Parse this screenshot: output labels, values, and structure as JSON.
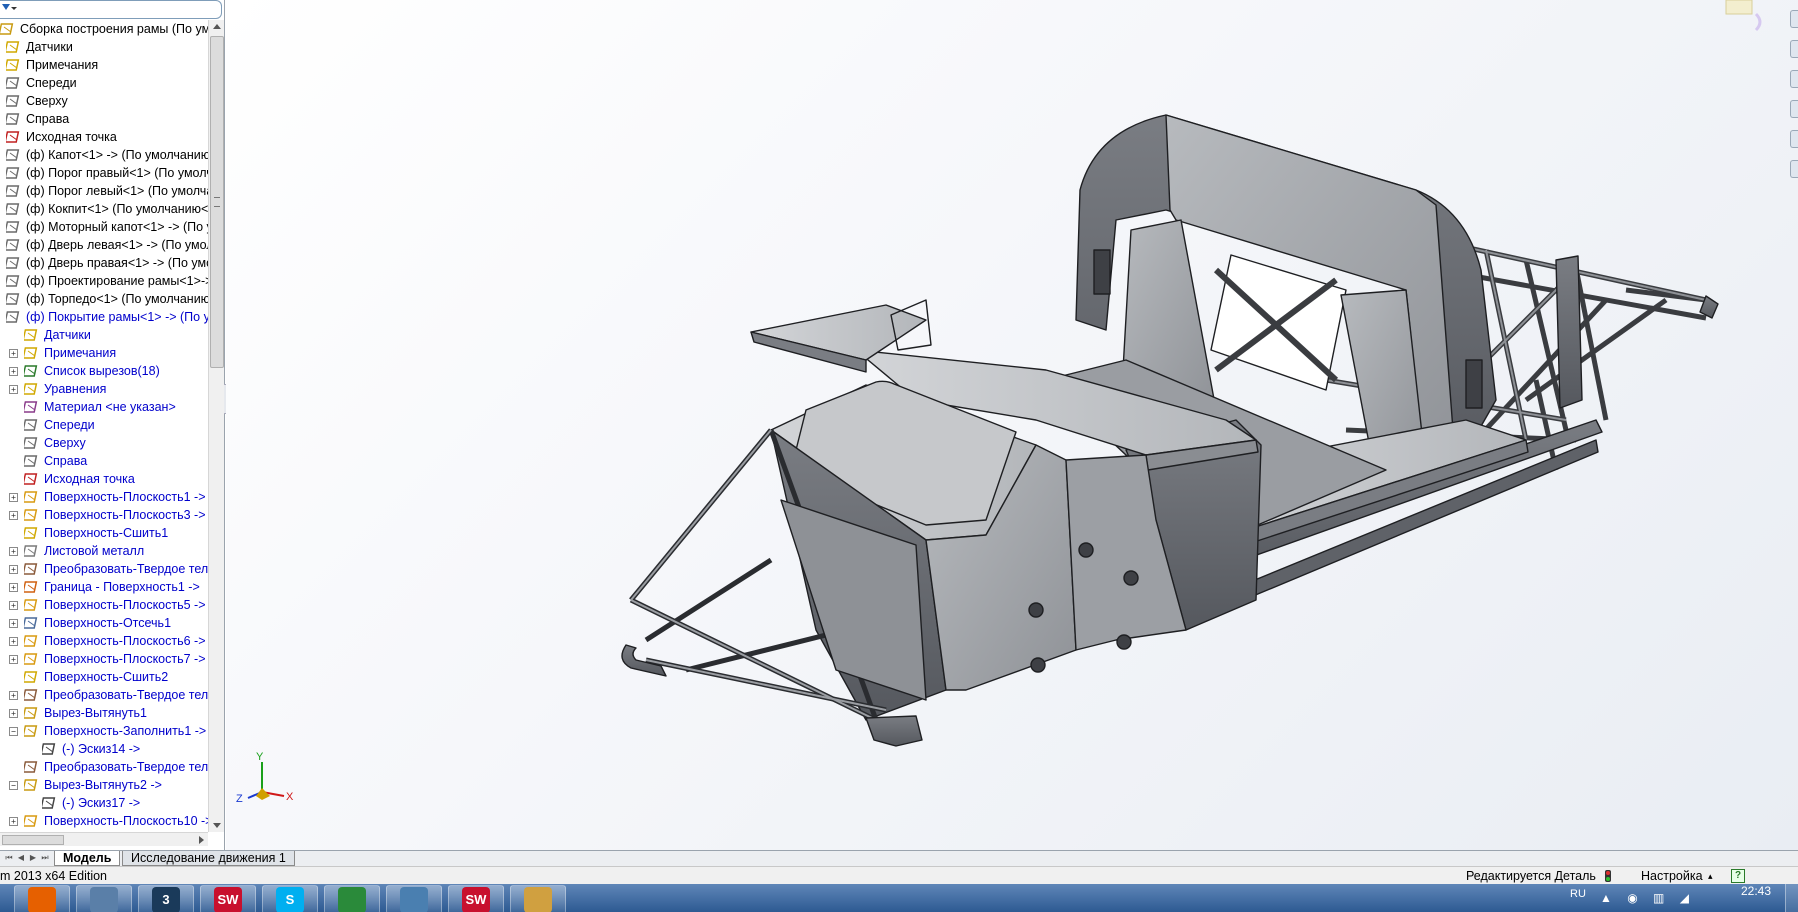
{
  "tree": {
    "rows": [
      {
        "label": "Сборка построения рамы  (По умол",
        "icon": "assembly-icon",
        "indent": 0,
        "expander": "",
        "blue": false
      },
      {
        "label": "Датчики",
        "icon": "sensors-icon",
        "indent": 1,
        "expander": "",
        "blue": false
      },
      {
        "label": "Примечания",
        "icon": "annotations-icon",
        "indent": 1,
        "expander": "",
        "blue": false
      },
      {
        "label": "Спереди",
        "icon": "plane-icon",
        "indent": 1,
        "expander": "",
        "blue": false
      },
      {
        "label": "Сверху",
        "icon": "plane-icon",
        "indent": 1,
        "expander": "",
        "blue": false
      },
      {
        "label": "Справа",
        "icon": "plane-icon",
        "indent": 1,
        "expander": "",
        "blue": false
      },
      {
        "label": "Исходная точка",
        "icon": "origin-icon",
        "indent": 1,
        "expander": "",
        "blue": false
      },
      {
        "label": "(ф) Капот<1> -> (По умолчанию",
        "icon": "part-icon",
        "indent": 1,
        "expander": "",
        "blue": false
      },
      {
        "label": "(ф) Порог правый<1> (По умолч",
        "icon": "part-icon",
        "indent": 1,
        "expander": "",
        "blue": false
      },
      {
        "label": "(ф) Порог левый<1> (По умолча",
        "icon": "part-icon",
        "indent": 1,
        "expander": "",
        "blue": false
      },
      {
        "label": "(ф) Кокпит<1> (По умолчанию<",
        "icon": "part-icon",
        "indent": 1,
        "expander": "",
        "blue": false
      },
      {
        "label": "(ф) Моторный капот<1> -> (По у",
        "icon": "part-icon",
        "indent": 1,
        "expander": "",
        "blue": false
      },
      {
        "label": "(ф) Дверь левая<1> -> (По умол",
        "icon": "part-icon",
        "indent": 1,
        "expander": "",
        "blue": false
      },
      {
        "label": "(ф) Дверь правая<1> -> (По умо.",
        "icon": "part-icon",
        "indent": 1,
        "expander": "",
        "blue": false
      },
      {
        "label": "(ф) Проектирование рамы<1>->",
        "icon": "part-icon",
        "indent": 1,
        "expander": "",
        "blue": false
      },
      {
        "label": "(ф) Торпедо<1> (По умолчанию",
        "icon": "part-icon",
        "indent": 1,
        "expander": "",
        "blue": false
      },
      {
        "label": "(ф) Покрытие рамы<1> -> (По у",
        "icon": "part-icon",
        "indent": 1,
        "expander": "",
        "blue": true
      },
      {
        "label": "Датчики",
        "icon": "sensors-icon",
        "indent": 2,
        "expander": "",
        "blue": true
      },
      {
        "label": "Примечания",
        "icon": "annotations-icon",
        "indent": 2,
        "expander": "+",
        "blue": true
      },
      {
        "label": "Список вырезов(18)",
        "icon": "cutlist-icon",
        "indent": 2,
        "expander": "+",
        "blue": true
      },
      {
        "label": "Уравнения",
        "icon": "equations-icon",
        "indent": 2,
        "expander": "+",
        "blue": true
      },
      {
        "label": "Материал <не указан>",
        "icon": "material-icon",
        "indent": 2,
        "expander": "",
        "blue": true
      },
      {
        "label": "Спереди",
        "icon": "plane-icon",
        "indent": 2,
        "expander": "",
        "blue": true
      },
      {
        "label": "Сверху",
        "icon": "plane-icon",
        "indent": 2,
        "expander": "",
        "blue": true
      },
      {
        "label": "Справа",
        "icon": "plane-icon",
        "indent": 2,
        "expander": "",
        "blue": true
      },
      {
        "label": "Исходная точка",
        "icon": "origin-icon",
        "indent": 2,
        "expander": "",
        "blue": true
      },
      {
        "label": "Поверхность-Плоскость1 ->",
        "icon": "surface-icon",
        "indent": 2,
        "expander": "+",
        "blue": true
      },
      {
        "label": "Поверхность-Плоскость3 ->",
        "icon": "surface-icon",
        "indent": 2,
        "expander": "+",
        "blue": true
      },
      {
        "label": "Поверхность-Сшить1",
        "icon": "knit-icon",
        "indent": 2,
        "expander": "",
        "blue": true
      },
      {
        "label": "Листовой металл",
        "icon": "sheetmetal-icon",
        "indent": 2,
        "expander": "+",
        "blue": true
      },
      {
        "label": "Преобразовать-Твердое тело",
        "icon": "convert-icon",
        "indent": 2,
        "expander": "+",
        "blue": true
      },
      {
        "label": "Граница - Поверхность1 ->",
        "icon": "boundary-icon",
        "indent": 2,
        "expander": "+",
        "blue": true
      },
      {
        "label": "Поверхность-Плоскость5 ->",
        "icon": "surface-icon",
        "indent": 2,
        "expander": "+",
        "blue": true
      },
      {
        "label": "Поверхность-Отсечь1",
        "icon": "trim-icon",
        "indent": 2,
        "expander": "+",
        "blue": true
      },
      {
        "label": "Поверхность-Плоскость6 ->",
        "icon": "surface-icon",
        "indent": 2,
        "expander": "+",
        "blue": true
      },
      {
        "label": "Поверхность-Плоскость7 ->",
        "icon": "surface-icon",
        "indent": 2,
        "expander": "+",
        "blue": true
      },
      {
        "label": "Поверхность-Сшить2",
        "icon": "knit-icon",
        "indent": 2,
        "expander": "",
        "blue": true
      },
      {
        "label": "Преобразовать-Твердое тело",
        "icon": "convert-icon",
        "indent": 2,
        "expander": "+",
        "blue": true
      },
      {
        "label": "Вырез-Вытянуть1",
        "icon": "cut-extrude-icon",
        "indent": 2,
        "expander": "+",
        "blue": true
      },
      {
        "label": "Поверхность-Заполнить1 ->",
        "icon": "fill-icon",
        "indent": 2,
        "expander": "−",
        "blue": true
      },
      {
        "label": "(-) Эскиз14 ->",
        "icon": "sketch-icon",
        "indent": 3,
        "expander": "",
        "blue": true
      },
      {
        "label": "Преобразовать-Твердое тело",
        "icon": "convert-icon",
        "indent": 2,
        "expander": "",
        "blue": true
      },
      {
        "label": "Вырез-Вытянуть2 ->",
        "icon": "cut-extrude-icon",
        "indent": 2,
        "expander": "−",
        "blue": true
      },
      {
        "label": "(-) Эскиз17 ->",
        "icon": "sketch-icon",
        "indent": 3,
        "expander": "",
        "blue": true
      },
      {
        "label": "Поверхность-Плоскость10 ->",
        "icon": "surface-icon",
        "indent": 2,
        "expander": "+",
        "blue": true
      }
    ]
  },
  "triad": {
    "x": "X",
    "y": "Y",
    "z": "Z"
  },
  "tabs": [
    {
      "label": "Модель",
      "active": true
    },
    {
      "label": "Исследование движения 1",
      "active": false
    }
  ],
  "status": {
    "left": "m 2013 x64 Edition",
    "editing": "Редактируется Деталь",
    "settings": "Настройка",
    "settings_caret": "▴",
    "help": "?"
  },
  "taskbar": {
    "apps": [
      {
        "name": "firefox-icon",
        "label": "",
        "color": "#e66000"
      },
      {
        "name": "calculator-icon",
        "label": "",
        "color": "#5a7fa8"
      },
      {
        "name": "3ds-max-icon",
        "label": "3",
        "color": "#1a3a5a"
      },
      {
        "name": "solidworks-icon",
        "label": "SW",
        "color": "#c8102e"
      },
      {
        "name": "skype-icon",
        "label": "S",
        "color": "#00aff0"
      },
      {
        "name": "chrome-icon",
        "label": "",
        "color": "#2a8a3a"
      },
      {
        "name": "photos-icon",
        "label": "",
        "color": "#4a7fb0"
      },
      {
        "name": "solidworks-icon",
        "label": "SW",
        "color": "#c8102e"
      },
      {
        "name": "paint-icon",
        "label": "",
        "color": "#d0a040"
      }
    ],
    "lang": "RU",
    "time": "22:43"
  },
  "colors": {
    "tree_blue": "#0000cc",
    "model_face": "#a7aaaf",
    "model_dark": "#6b6e74",
    "model_light": "#c9cbcf",
    "edge": "#1e1f22"
  }
}
